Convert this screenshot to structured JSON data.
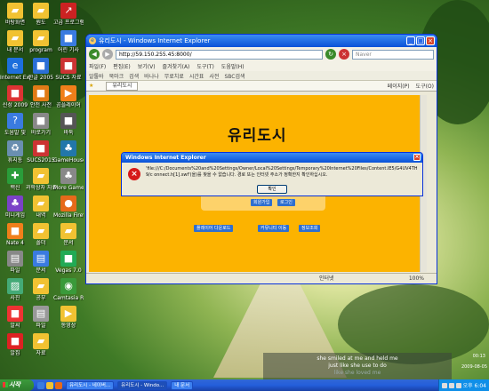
{
  "desktop_icons": [
    {
      "label": "바탕화면",
      "icon": "folder-icon",
      "color": "#f1c232"
    },
    {
      "label": "내 문서",
      "icon": "folder-icon",
      "color": "#f1c232"
    },
    {
      "label": "Internet Explorer",
      "icon": "ie-icon",
      "color": "#1d6fdc"
    },
    {
      "label": "신성 2009",
      "icon": "app-icon",
      "color": "#d33"
    },
    {
      "label": "도움말 및",
      "icon": "help-icon",
      "color": "#3a7be0"
    },
    {
      "label": "휴지통",
      "icon": "recycle-bin-icon",
      "color": "#6a8fb0"
    },
    {
      "label": "백신",
      "icon": "shield-icon",
      "color": "#2a9d3a"
    },
    {
      "label": "미니게임",
      "icon": "game-icon",
      "color": "#7b42c7"
    },
    {
      "label": "Nate 4",
      "icon": "app-icon",
      "color": "#f07f1a"
    },
    {
      "label": "파일",
      "icon": "file-icon",
      "color": "#888"
    },
    {
      "label": "사진",
      "icon": "image-icon",
      "color": "#4a7"
    },
    {
      "label": "알씨",
      "icon": "app-icon",
      "color": "#e33"
    },
    {
      "label": "알집",
      "icon": "app-icon",
      "color": "#d22"
    }
  ],
  "desktop_icons_col2": [
    {
      "label": "원도",
      "icon": "folder-icon",
      "color": "#f1c232"
    },
    {
      "label": "program",
      "icon": "folder-icon",
      "color": "#f1c232"
    },
    {
      "label": "한글 2005",
      "icon": "app-icon",
      "color": "#2b6fd6"
    },
    {
      "label": "안전 사전",
      "icon": "app-icon",
      "color": "#e07b16"
    },
    {
      "label": "바로가기",
      "icon": "app-icon",
      "color": "#888"
    },
    {
      "label": "SUCS2015",
      "icon": "app-icon",
      "color": "#c33"
    },
    {
      "label": "과학상자 자료",
      "icon": "folder-icon",
      "color": "#f1c232"
    },
    {
      "label": "내역",
      "icon": "folder-icon",
      "color": "#f1c232"
    },
    {
      "label": "폴더",
      "icon": "folder-icon",
      "color": "#f1c232"
    },
    {
      "label": "문서",
      "icon": "file-icon",
      "color": "#3a7be0"
    },
    {
      "label": "공부",
      "icon": "folder-icon",
      "color": "#f1c232"
    },
    {
      "label": "파일",
      "icon": "file-icon",
      "color": "#999"
    },
    {
      "label": "자료",
      "icon": "folder-icon",
      "color": "#f1c232"
    }
  ],
  "desktop_icons_col3": [
    {
      "label": "고급 프로그램",
      "icon": "shortcut-icon",
      "color": "#c22"
    },
    {
      "label": "어린 기사",
      "icon": "app-icon",
      "color": "#3a7be0"
    },
    {
      "label": "SUCS 자료",
      "icon": "app-icon",
      "color": "#c33"
    },
    {
      "label": "곰플레이어",
      "icon": "player-icon",
      "color": "#f07f1a"
    },
    {
      "label": "바둑",
      "icon": "app-icon",
      "color": "#555"
    },
    {
      "label": "GameHouse Studios",
      "icon": "game-icon",
      "color": "#27a"
    },
    {
      "label": "More Games at",
      "icon": "game-icon",
      "color": "#888"
    },
    {
      "label": "Mozilla Firefox",
      "icon": "firefox-icon",
      "color": "#e66a1a"
    },
    {
      "label": "문서",
      "icon": "folder-icon",
      "color": "#f1c232"
    },
    {
      "label": "Vegas 7.0",
      "icon": "app-icon",
      "color": "#2a5"
    },
    {
      "label": "Camtasia Recorder",
      "icon": "recorder-icon",
      "color": "#3a9a3a"
    },
    {
      "label": "동영상",
      "icon": "video-icon",
      "color": "#f1c232"
    }
  ],
  "ie": {
    "title": "유리도시 - Windows Internet Explorer",
    "url": "http://59.150.255.45:8000/",
    "search_placeholder": "Naver",
    "menus": [
      "파일(F)",
      "편집(E)",
      "보기(V)",
      "즐겨찾기(A)",
      "도구(T)",
      "도움말(H)"
    ],
    "links": [
      "알툴바",
      "북마크",
      "검색",
      "바나나",
      "무료치료",
      "시간표",
      "사전",
      "SBC검색"
    ],
    "tab": "유리도시",
    "tools": [
      "페이지(P)",
      "도구(O)"
    ],
    "status_zone": "인터넷",
    "status_zoom": "100%"
  },
  "page": {
    "logo": "유리도시",
    "btn1": "회원가입",
    "btn2": "로그인",
    "link1": "플레이어 다운로드",
    "link2": "커뮤니티 이동",
    "link3": "정보조회"
  },
  "dialog": {
    "title": "Windows Internet Explorer",
    "message": "'file:///C:/Documents%20and%20Settings/Owner/Local%20Settings/Temporary%20Internet%20Files/Content.IE5/G4UV4TH9/c onnect.h[1].swf'(을)를 찾을 수 없습니다. 경로 또는 인터넷 주소가 정확한지 확인하십시오.",
    "ok": "확인"
  },
  "taskbar": {
    "start": "시작",
    "tasks": [
      "유리도시 - 네이버...",
      "유리도시 - Windo...",
      "내 문서"
    ],
    "clock": "오후 6:04"
  },
  "lyrics": {
    "line1": "she smiled at me and held me",
    "line2": "just like she use to do",
    "line3": "like she loved me",
    "time": "00:13",
    "date": "2009-08-05"
  }
}
